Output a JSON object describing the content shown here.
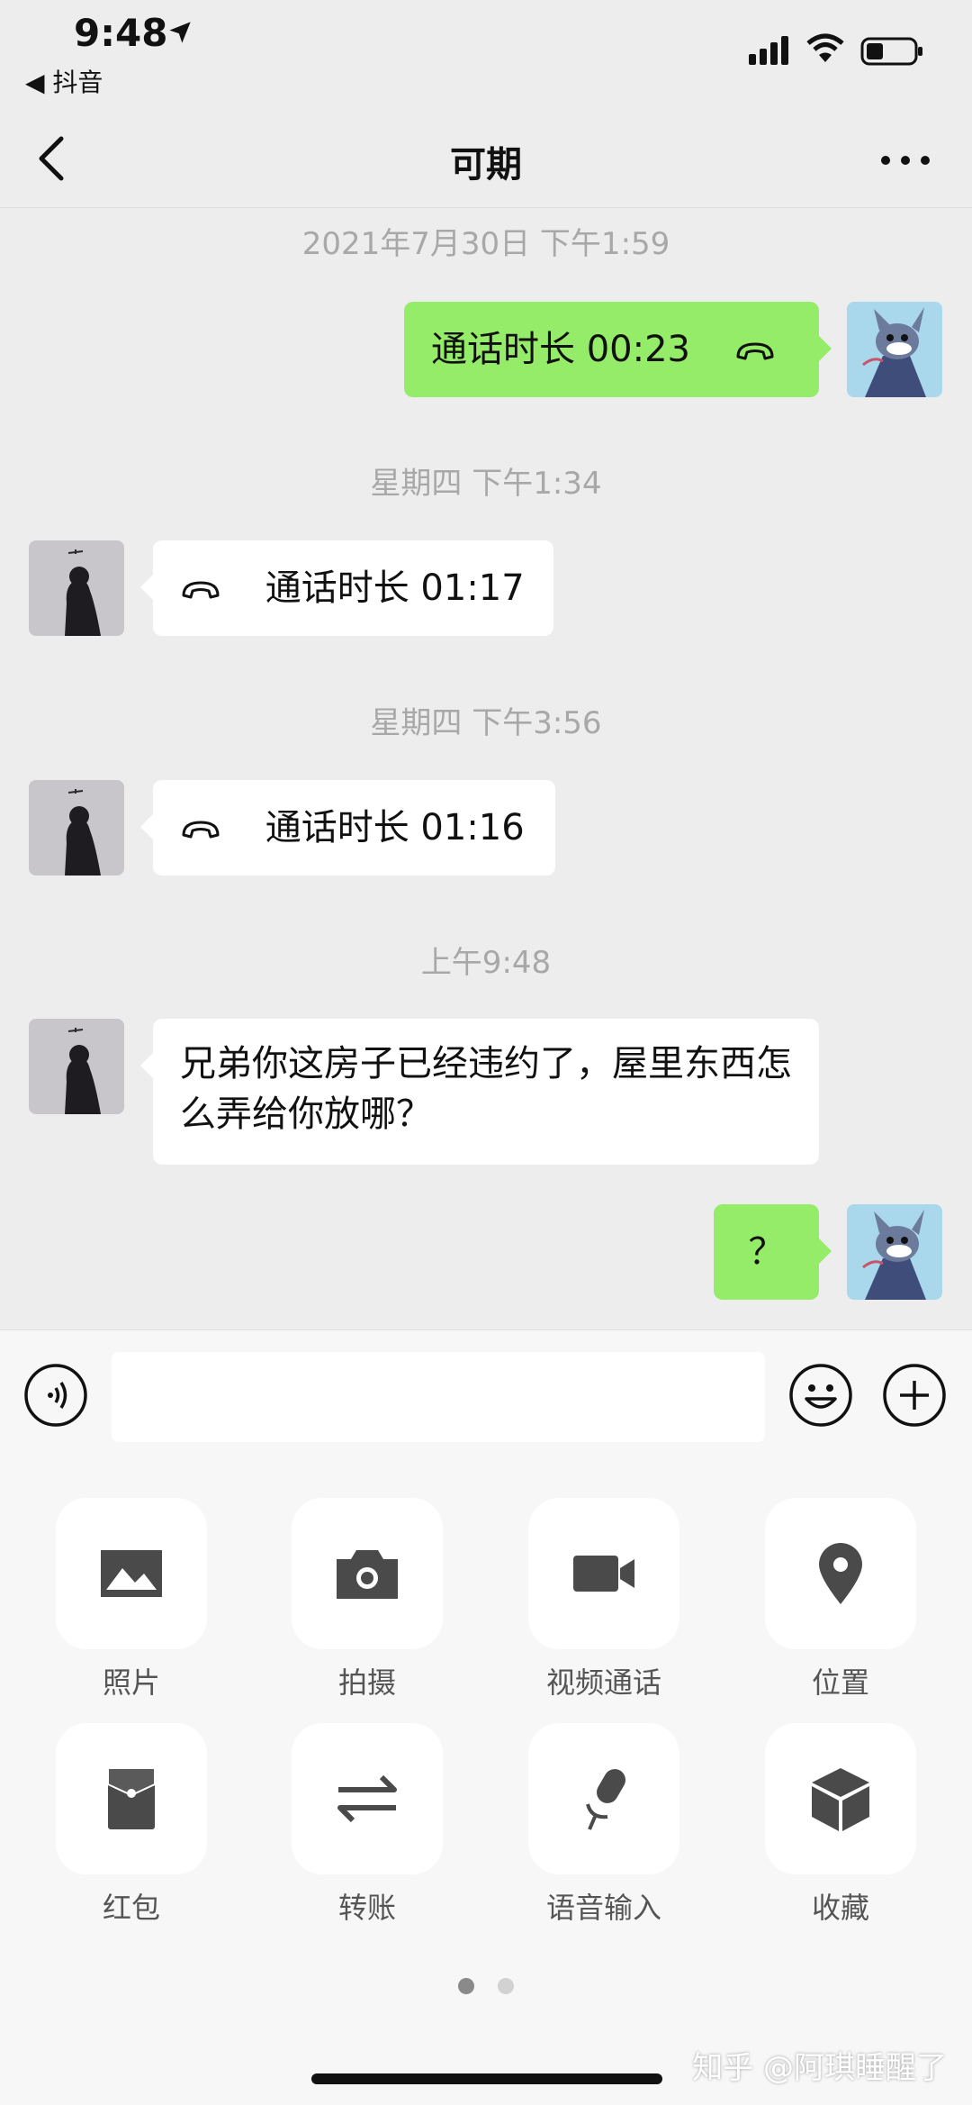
{
  "status_bar": {
    "time": "9:48",
    "back_app": "◀ 抖音"
  },
  "nav": {
    "title": "可期"
  },
  "messages": [
    {
      "timestamp": "2021年7月30日 下午1:59"
    },
    {
      "side": "right",
      "type": "call",
      "text": "通话时长 00:23"
    },
    {
      "timestamp": "星期四 下午1:34"
    },
    {
      "side": "left",
      "type": "call",
      "text": "通话时长 01:17"
    },
    {
      "timestamp": "星期四 下午3:56"
    },
    {
      "side": "left",
      "type": "call",
      "text": "通话时长 01:16"
    },
    {
      "timestamp": "上午9:48"
    },
    {
      "side": "left",
      "type": "text",
      "text": "兄弟你这房子已经违约了，屋里东西怎么弄给你放哪？"
    },
    {
      "side": "right",
      "type": "text",
      "text": "？"
    }
  ],
  "input": {
    "value": "",
    "placeholder": ""
  },
  "panel": {
    "items": [
      {
        "label": "照片",
        "icon": "photo-icon"
      },
      {
        "label": "拍摄",
        "icon": "camera-icon"
      },
      {
        "label": "视频通话",
        "icon": "video-call-icon"
      },
      {
        "label": "位置",
        "icon": "location-icon"
      },
      {
        "label": "红包",
        "icon": "red-packet-icon"
      },
      {
        "label": "转账",
        "icon": "transfer-icon"
      },
      {
        "label": "语音输入",
        "icon": "microphone-icon"
      },
      {
        "label": "收藏",
        "icon": "favorites-icon"
      }
    ],
    "page_count": 2,
    "active_page": 1
  },
  "watermark": "知乎 @阿琪睡醒了",
  "colors": {
    "background": "#ededed",
    "sent_bubble": "#95ec69",
    "received_bubble": "#ffffff",
    "panel": "#f7f7f7"
  }
}
